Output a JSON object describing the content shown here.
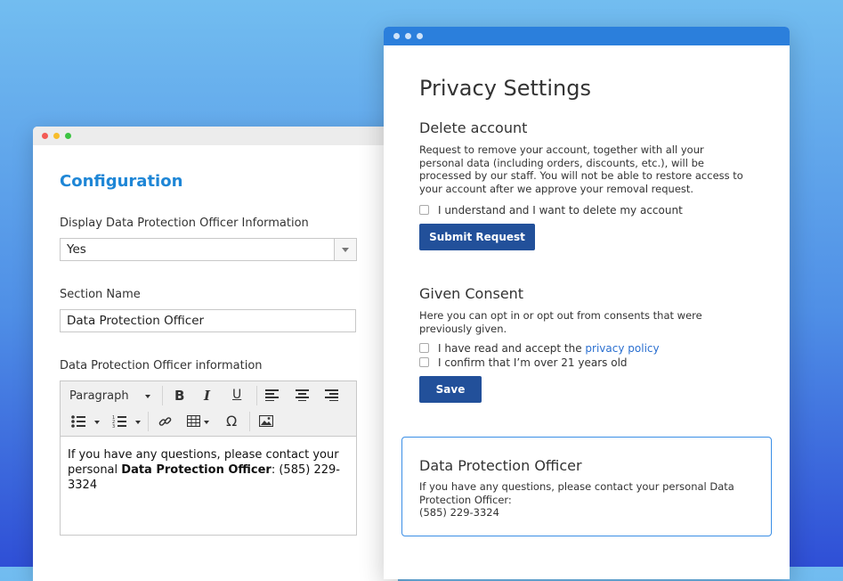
{
  "config_window": {
    "title": "Configuration",
    "display_label": "Display Data Protection Officer Information",
    "display_value": "Yes",
    "section_name_label": "Section Name",
    "section_name_value": "Data Protection Officer",
    "dpo_info_label": "Data Protection Officer information",
    "editor": {
      "format_select": "Paragraph",
      "content_prefix": "If you have any questions, please contact your personal ",
      "content_bold": "Data Protection Officer",
      "content_suffix": ": (585) 229-3324"
    }
  },
  "privacy_window": {
    "title": "Privacy Settings",
    "delete_account": {
      "heading": "Delete account",
      "description": "Request to remove your account, together with all your personal data (including orders, discounts, etc.), will be processed by our staff. You will not be able to restore access to your account after we approve your removal request.",
      "checkbox_label": "I understand and I want to delete my account",
      "submit_label": "Submit Request"
    },
    "consent": {
      "heading": "Given Consent",
      "description": "Here you can opt in or opt out from consents that were previously given.",
      "privacy_prefix": "I have read and accept the ",
      "privacy_link": "privacy policy",
      "age_label": "I confirm that I’m over 21 years old",
      "save_label": "Save"
    },
    "dpo_card": {
      "heading": "Data Protection Officer",
      "line1": "If you have any questions, please contact your personal Data Protection Officer:",
      "line2": "(585) 229-3324"
    }
  },
  "colors": {
    "accent_blue": "#1e86d6",
    "button_blue": "#22509a",
    "titlebar_blue": "#2b7fdc",
    "link_blue": "#2a6fd0"
  },
  "icons": [
    "bold-icon",
    "italic-icon",
    "underline-icon",
    "align-left-icon",
    "align-center-icon",
    "align-right-icon",
    "bullet-list-icon",
    "numbered-list-icon",
    "link-icon",
    "table-icon",
    "omega-icon",
    "image-icon"
  ]
}
